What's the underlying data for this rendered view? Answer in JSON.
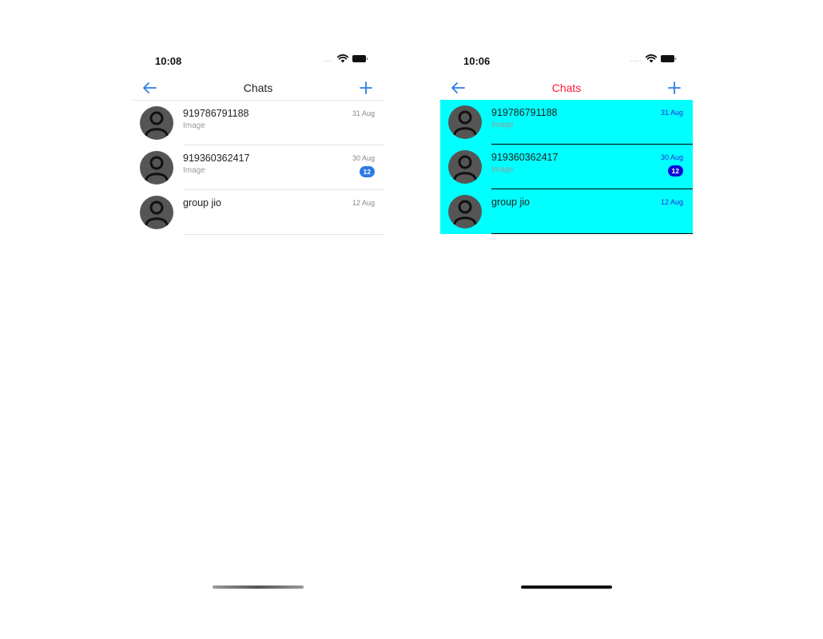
{
  "screens": [
    {
      "status_time": "10:08",
      "signal": ".....",
      "title": "Chats",
      "chats": [
        {
          "name": "919786791188",
          "subtitle": "Image",
          "date": "31 Aug",
          "unread": ""
        },
        {
          "name": "919360362417",
          "subtitle": "Image",
          "date": "30 Aug",
          "unread": "12"
        },
        {
          "name": "group jio",
          "subtitle": "",
          "date": "12 Aug",
          "unread": ""
        }
      ]
    },
    {
      "status_time": "10:06",
      "signal": ".....",
      "title": "Chats",
      "chats": [
        {
          "name": "919786791188",
          "subtitle": "Image",
          "date": "31 Aug",
          "unread": ""
        },
        {
          "name": "919360362417",
          "subtitle": "Image",
          "date": "30 Aug",
          "unread": "12"
        },
        {
          "name": "group jio",
          "subtitle": "",
          "date": "12 Aug",
          "unread": ""
        }
      ]
    }
  ],
  "icons": {
    "back": "arrow-left-icon",
    "add": "plus-icon",
    "wifi": "wifi-icon",
    "battery": "battery-icon",
    "avatar": "person-placeholder-icon"
  },
  "colors": {
    "accent": "#2d7be5",
    "right_background": "#00ffff",
    "right_title": "#ff1a3c",
    "right_badge": "#0a0adc"
  }
}
